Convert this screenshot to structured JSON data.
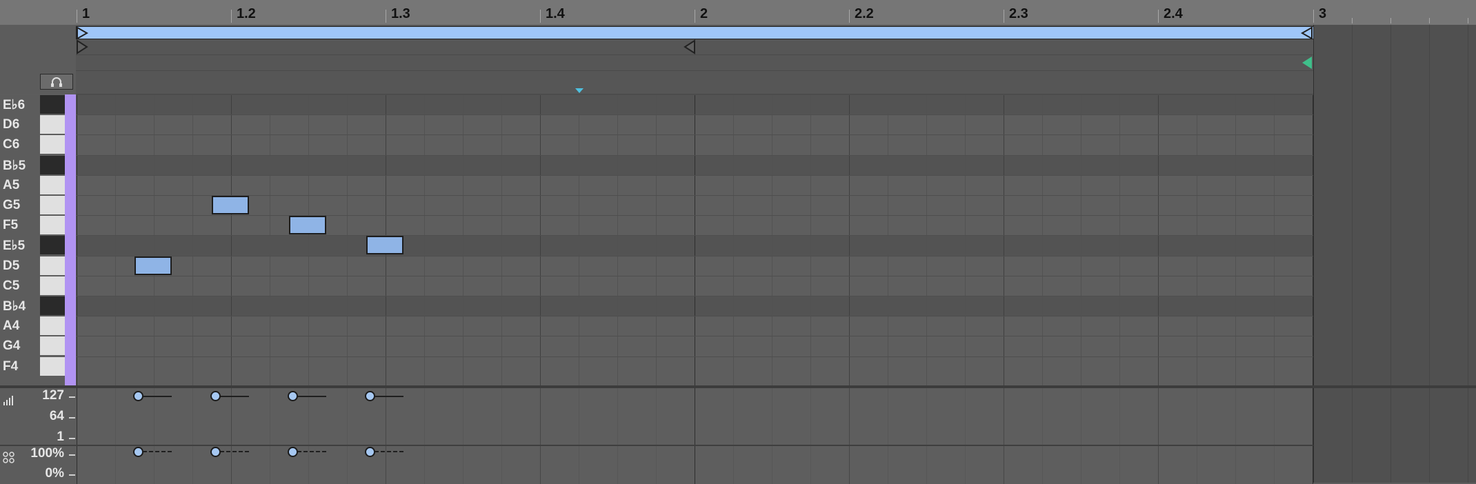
{
  "ruler": {
    "labels": [
      "1",
      "1.2",
      "1.3",
      "1.4",
      "2",
      "2.2",
      "2.3",
      "2.4",
      "3"
    ]
  },
  "keyboard": {
    "keys": [
      {
        "label": "E♭6",
        "color": "black"
      },
      {
        "label": "D6",
        "color": "white"
      },
      {
        "label": "C6",
        "color": "white"
      },
      {
        "label": "B♭5",
        "color": "black"
      },
      {
        "label": "A5",
        "color": "white"
      },
      {
        "label": "G5",
        "color": "white"
      },
      {
        "label": "F5",
        "color": "white"
      },
      {
        "label": "E♭5",
        "color": "black"
      },
      {
        "label": "D5",
        "color": "white"
      },
      {
        "label": "C5",
        "color": "white"
      },
      {
        "label": "B♭4",
        "color": "black"
      },
      {
        "label": "A4",
        "color": "white"
      },
      {
        "label": "G4",
        "color": "white"
      },
      {
        "label": "F4",
        "color": "white"
      }
    ]
  },
  "notes": [
    {
      "pitch": "D5",
      "start_beat": 1.5
    },
    {
      "pitch": "G5",
      "start_beat": 3.5
    },
    {
      "pitch": "F5",
      "start_beat": 5.5
    },
    {
      "pitch": "E♭5",
      "start_beat": 7.5
    }
  ],
  "velocity_lane": {
    "labels": [
      "127",
      "64",
      "1"
    ]
  },
  "chance_lane": {
    "labels": [
      "100%",
      "0%"
    ]
  },
  "icons": {
    "fold": "headphones-icon",
    "velocity": "velocity-bars-icon",
    "chance": "chance-dice-icon"
  },
  "colors": {
    "note": "#8fb4e6",
    "loop": "#9fc6f8",
    "keys_strip": "#b193f2",
    "end_marker": "#3fbf8a"
  }
}
